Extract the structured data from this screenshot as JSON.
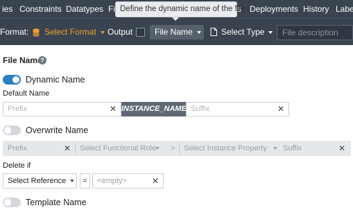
{
  "top_tabs": [
    {
      "label": "ies"
    },
    {
      "label": "Constraints"
    },
    {
      "label": "Datatypes"
    },
    {
      "label": "Fi"
    },
    {
      "label": "s"
    },
    {
      "label": "Deployments"
    },
    {
      "label": "History"
    },
    {
      "label": "Label"
    }
  ],
  "tooltip": "Define the dynamic name of the file",
  "toolbar": {
    "format_label": "Format:",
    "select_format": "Select Format",
    "output_label": "Output",
    "file_name": "File Name",
    "select_type": "Select Type",
    "description_placeholder": "File description"
  },
  "colors": {
    "topbar_bg": "#3a4450",
    "accent_orange": "#f0a030",
    "toggle_on": "#2a7fc1",
    "instance_badge_bg": "#5f6873"
  },
  "section": {
    "title": "File Name",
    "help_icon": "question-circle-icon"
  },
  "dynamic_name": {
    "label": "Dynamic Name",
    "enabled": true
  },
  "default_name": {
    "label": "Default Name",
    "prefix_placeholder": "Prefix",
    "instance_token": "INSTANCE_NAME",
    "suffix_placeholder": "Suffix",
    "clear_glyph": "✕"
  },
  "overwrite_name": {
    "label": "Overwrite Name",
    "enabled": false,
    "prefix_placeholder": "Prefix",
    "functional_role_placeholder": "Select Functional Role",
    "instance_property_placeholder": "Select Instance Property",
    "suffix_placeholder": "Suffix",
    "arrow_glyph": ">"
  },
  "delete_if": {
    "label": "Delete if",
    "reference_select": "Select Reference",
    "operator": "=",
    "value_placeholder": "<empty>"
  },
  "template_name": {
    "label": "Template Name",
    "enabled": false
  }
}
